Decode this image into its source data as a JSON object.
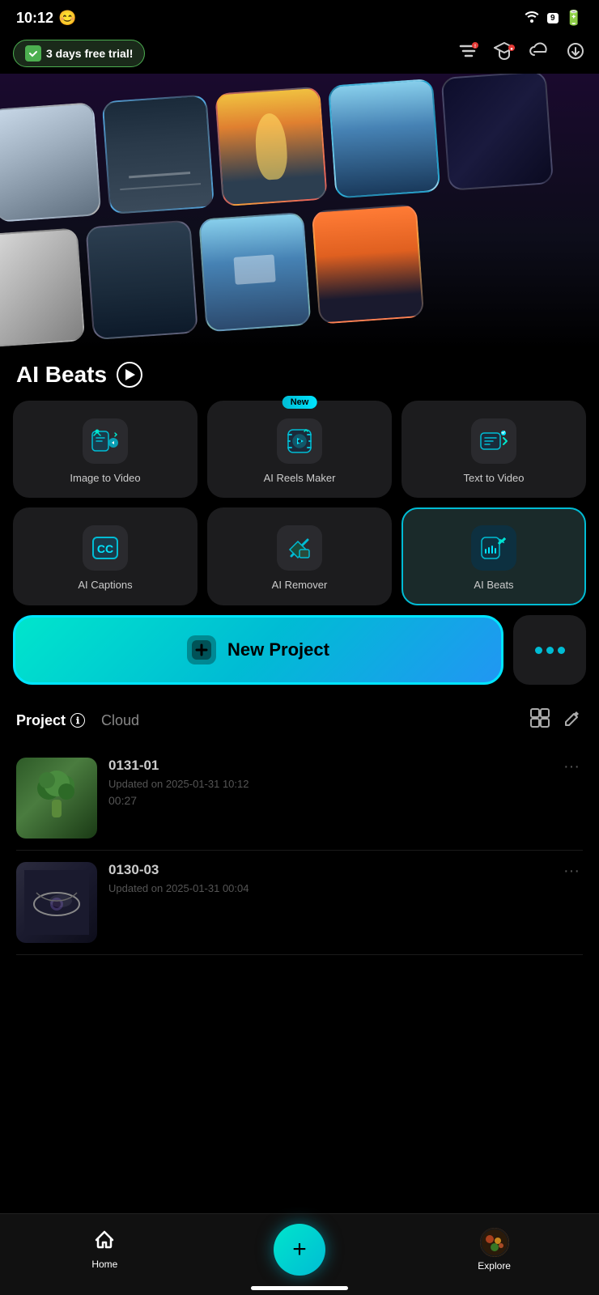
{
  "statusBar": {
    "time": "10:12",
    "emoji": "😊",
    "batteryNum": "9"
  },
  "trialBanner": {
    "label": "3 days free trial!",
    "filterIcon": "⊞",
    "educationIcon": "🎓",
    "cloudIcon": "☁",
    "downloadIcon": "⬇"
  },
  "hero": {
    "sectionTitle": "AI Beats",
    "playLabel": "play"
  },
  "tools": [
    {
      "id": "image-to-video",
      "label": "Image to Video",
      "new": false
    },
    {
      "id": "ai-reels-maker",
      "label": "AI Reels Maker",
      "new": true
    },
    {
      "id": "text-to-video",
      "label": "Text  to Video",
      "new": false
    },
    {
      "id": "ai-captions",
      "label": "AI Captions",
      "new": false
    },
    {
      "id": "ai-remover",
      "label": "AI Remover",
      "new": false
    },
    {
      "id": "ai-beats",
      "label": "AI Beats",
      "new": false,
      "highlighted": true
    }
  ],
  "newProject": {
    "label": "New Project",
    "plusIcon": "+"
  },
  "moreButton": {
    "dots": [
      "•",
      "•",
      "•"
    ]
  },
  "projectSection": {
    "tabs": [
      {
        "id": "project",
        "label": "Project",
        "info": "ℹ",
        "active": true
      },
      {
        "id": "cloud",
        "label": "Cloud",
        "active": false
      }
    ],
    "gridIcon": "⊞",
    "editIcon": "✎",
    "items": [
      {
        "id": "proj-1",
        "name": "0131-01",
        "updated": "Updated on 2025-01-31 10:12",
        "duration": "00:27",
        "thumb": "broccoli"
      },
      {
        "id": "proj-2",
        "name": "0130-03",
        "updated": "Updated on 2025-01-31 00:04",
        "duration": "",
        "thumb": "eye"
      }
    ]
  },
  "bottomNav": {
    "homeLabel": "Home",
    "exploreLabel": "Explore",
    "homeIcon": "🏠",
    "exploreIcon": "🍱"
  }
}
